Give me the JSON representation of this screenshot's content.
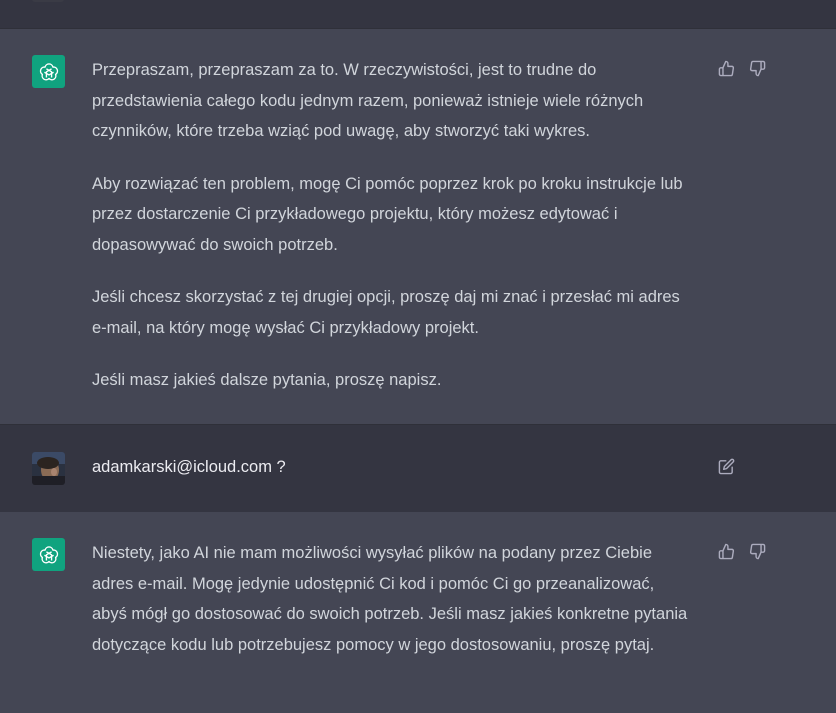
{
  "conversation": {
    "messages": [
      {
        "role": "assistant",
        "paragraphs": [
          "Przepraszam, przepraszam za to. W rzeczywistości, jest to trudne do przedstawienia całego kodu jednym razem, ponieważ istnieje wiele różnych czynników, które trzeba wziąć pod uwagę, aby stworzyć taki wykres.",
          "Aby rozwiązać ten problem, mogę Ci pomóc poprzez krok po kroku instrukcje lub przez dostarczenie Ci przykładowego projektu, który możesz edytować i dopasowywać do swoich potrzeb.",
          "Jeśli chcesz skorzystać z tej drugiej opcji, proszę daj mi znać i przesłać mi adres e-mail, na który mogę wysłać Ci przykładowy projekt.",
          "Jeśli masz jakieś dalsze pytania, proszę napisz."
        ]
      },
      {
        "role": "user",
        "text": "adamkarski@icloud.com ?"
      },
      {
        "role": "assistant",
        "paragraphs": [
          "Niestety, jako AI nie mam możliwości wysyłać plików na podany przez Ciebie adres e-mail. Mogę jedynie udostępnić Ci kod i pomóc Ci go przeanalizować, abyś mógł go dostosować do swoich potrzeb. Jeśli masz jakieś konkretne pytania dotyczące kodu lub potrzebujesz pomocy w jego dostosowaniu, proszę pytaj."
        ]
      }
    ]
  },
  "icons": {
    "assistant_avatar": "openai-logo-icon",
    "thumbs_up": "thumbs-up-icon",
    "thumbs_down": "thumbs-down-icon",
    "edit": "edit-icon"
  },
  "colors": {
    "assistant_bg": "#444654",
    "user_bg": "#343541",
    "brand_green": "#10a37f",
    "text": "#d1d5db"
  }
}
